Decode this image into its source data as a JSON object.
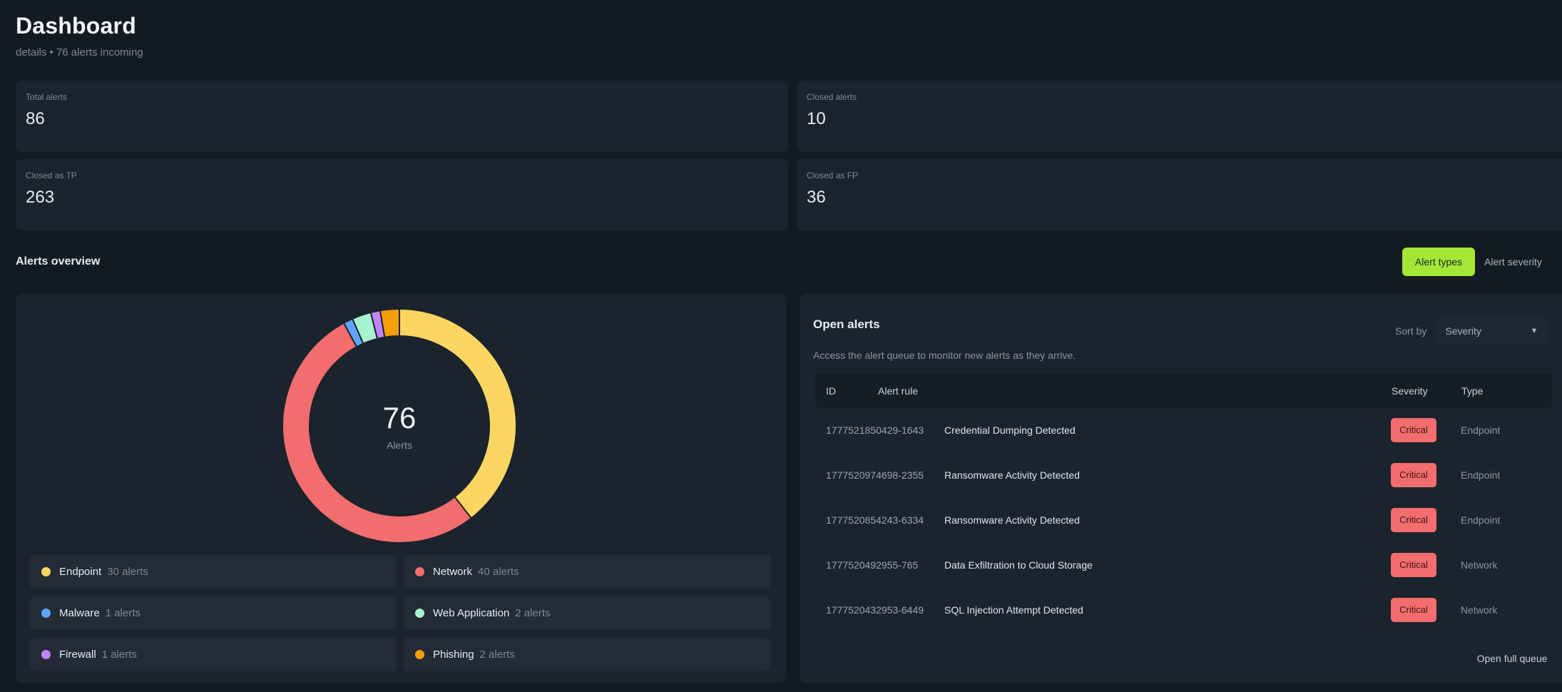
{
  "header": {
    "title": "Dashboard",
    "subtitle": "details • 76 alerts incoming"
  },
  "stats": [
    {
      "label": "Total alerts",
      "value": "86"
    },
    {
      "label": "Closed alerts",
      "value": "10"
    },
    {
      "label": "Closed as TP",
      "value": "263"
    },
    {
      "label": "Closed as FP",
      "value": "36"
    }
  ],
  "overview": {
    "title": "Alerts overview",
    "toggle": {
      "active": "Alert types",
      "inactive": "Alert severity"
    },
    "donut": {
      "total": "76",
      "label": "Alerts"
    },
    "legend": [
      {
        "name": "Endpoint",
        "count": "30 alerts",
        "value": 30,
        "color": "#fcd663"
      },
      {
        "name": "Network",
        "count": "40 alerts",
        "value": 40,
        "color": "#f26d6d"
      },
      {
        "name": "Malware",
        "count": "1 alerts",
        "value": 1,
        "color": "#60a5fa"
      },
      {
        "name": "Web Application",
        "count": "2 alerts",
        "value": 2,
        "color": "#a7f3d0"
      },
      {
        "name": "Firewall",
        "count": "1 alerts",
        "value": 1,
        "color": "#c084fc"
      },
      {
        "name": "Phishing",
        "count": "2 alerts",
        "value": 2,
        "color": "#f59e0b"
      }
    ]
  },
  "open_alerts": {
    "title": "Open alerts",
    "sort_label": "Sort by",
    "sort_value": "Severity",
    "description": "Access the alert queue to monitor new alerts as they arrive.",
    "columns": {
      "id": "ID",
      "rule": "Alert rule",
      "severity": "Severity",
      "type": "Type"
    },
    "rows": [
      {
        "id": "1777521850429-1643",
        "rule": "Credential Dumping Detected",
        "severity": "Critical",
        "type": "Endpoint"
      },
      {
        "id": "1777520974698-2355",
        "rule": "Ransomware Activity Detected",
        "severity": "Critical",
        "type": "Endpoint"
      },
      {
        "id": "1777520854243-6334",
        "rule": "Ransomware Activity Detected",
        "severity": "Critical",
        "type": "Endpoint"
      },
      {
        "id": "1777520492955-765",
        "rule": "Data Exfiltration to Cloud Storage",
        "severity": "Critical",
        "type": "Network"
      },
      {
        "id": "1777520432953-6449",
        "rule": "SQL Injection Attempt Detected",
        "severity": "Critical",
        "type": "Network"
      }
    ],
    "open_queue_label": "Open full queue"
  }
}
